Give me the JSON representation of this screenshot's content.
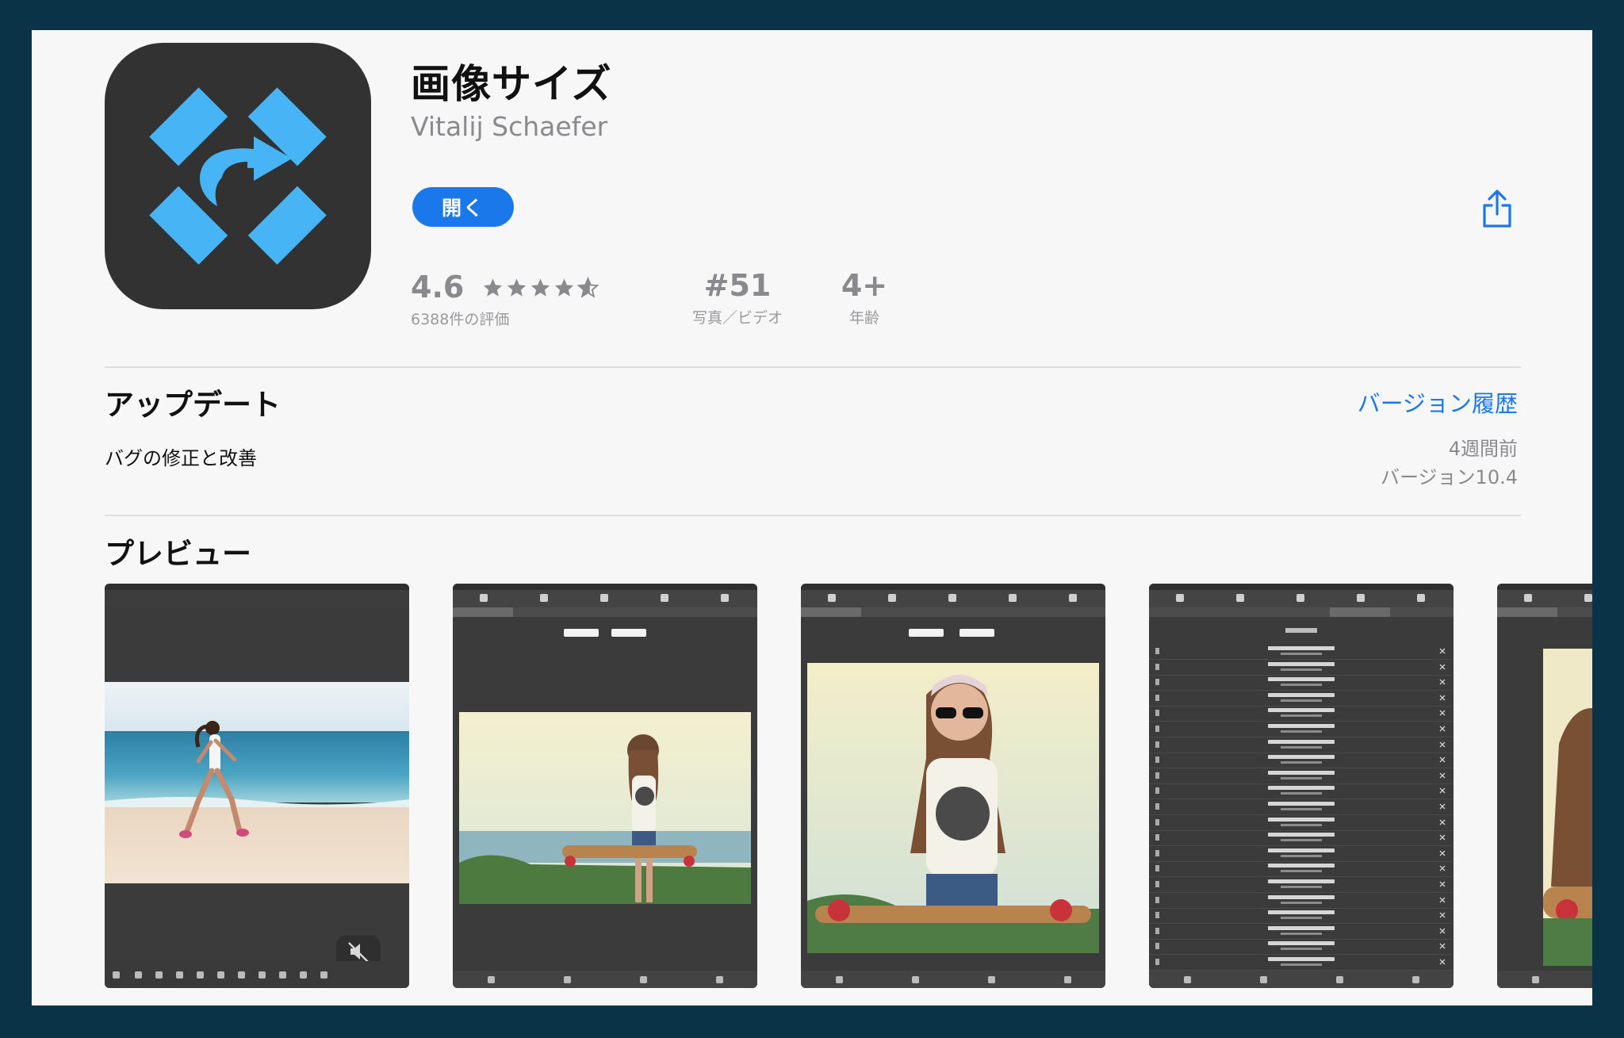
{
  "app": {
    "name": "画像サイズ",
    "developer": "Vitalij Schaefer",
    "open_label": "開く"
  },
  "stats": {
    "rating": "4.6",
    "rating_count": "6388件の評価",
    "stars": 4.6,
    "rank": "#51",
    "category": "写真／ビデオ",
    "age": "4+",
    "age_label": "年齢"
  },
  "update": {
    "title": "アップデート",
    "version_history": "バージョン履歴",
    "notes": "バグの修正と改善",
    "time_ago": "4週間前",
    "version": "バージョン10.4"
  },
  "preview": {
    "title": "プレビュー"
  },
  "colors": {
    "accent": "#1b78ea",
    "icon_bg": "#323232",
    "icon_mark": "#46b4f5",
    "outer_bg": "#0b3347"
  },
  "icons": [
    "share-icon",
    "star-icon",
    "app-logo-icon",
    "mute-icon"
  ]
}
